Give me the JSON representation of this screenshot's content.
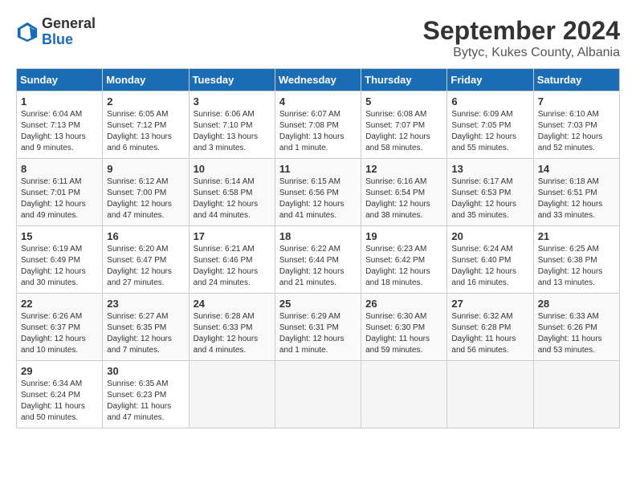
{
  "header": {
    "logo_general": "General",
    "logo_blue": "Blue",
    "title": "September 2024",
    "subtitle": "Bytyc, Kukes County, Albania"
  },
  "columns": [
    "Sunday",
    "Monday",
    "Tuesday",
    "Wednesday",
    "Thursday",
    "Friday",
    "Saturday"
  ],
  "weeks": [
    [
      {
        "day": "1",
        "info": "Sunrise: 6:04 AM\nSunset: 7:13 PM\nDaylight: 13 hours and 9 minutes."
      },
      {
        "day": "2",
        "info": "Sunrise: 6:05 AM\nSunset: 7:12 PM\nDaylight: 13 hours and 6 minutes."
      },
      {
        "day": "3",
        "info": "Sunrise: 6:06 AM\nSunset: 7:10 PM\nDaylight: 13 hours and 3 minutes."
      },
      {
        "day": "4",
        "info": "Sunrise: 6:07 AM\nSunset: 7:08 PM\nDaylight: 13 hours and 1 minute."
      },
      {
        "day": "5",
        "info": "Sunrise: 6:08 AM\nSunset: 7:07 PM\nDaylight: 12 hours and 58 minutes."
      },
      {
        "day": "6",
        "info": "Sunrise: 6:09 AM\nSunset: 7:05 PM\nDaylight: 12 hours and 55 minutes."
      },
      {
        "day": "7",
        "info": "Sunrise: 6:10 AM\nSunset: 7:03 PM\nDaylight: 12 hours and 52 minutes."
      }
    ],
    [
      {
        "day": "8",
        "info": "Sunrise: 6:11 AM\nSunset: 7:01 PM\nDaylight: 12 hours and 49 minutes."
      },
      {
        "day": "9",
        "info": "Sunrise: 6:12 AM\nSunset: 7:00 PM\nDaylight: 12 hours and 47 minutes."
      },
      {
        "day": "10",
        "info": "Sunrise: 6:14 AM\nSunset: 6:58 PM\nDaylight: 12 hours and 44 minutes."
      },
      {
        "day": "11",
        "info": "Sunrise: 6:15 AM\nSunset: 6:56 PM\nDaylight: 12 hours and 41 minutes."
      },
      {
        "day": "12",
        "info": "Sunrise: 6:16 AM\nSunset: 6:54 PM\nDaylight: 12 hours and 38 minutes."
      },
      {
        "day": "13",
        "info": "Sunrise: 6:17 AM\nSunset: 6:53 PM\nDaylight: 12 hours and 35 minutes."
      },
      {
        "day": "14",
        "info": "Sunrise: 6:18 AM\nSunset: 6:51 PM\nDaylight: 12 hours and 33 minutes."
      }
    ],
    [
      {
        "day": "15",
        "info": "Sunrise: 6:19 AM\nSunset: 6:49 PM\nDaylight: 12 hours and 30 minutes."
      },
      {
        "day": "16",
        "info": "Sunrise: 6:20 AM\nSunset: 6:47 PM\nDaylight: 12 hours and 27 minutes."
      },
      {
        "day": "17",
        "info": "Sunrise: 6:21 AM\nSunset: 6:46 PM\nDaylight: 12 hours and 24 minutes."
      },
      {
        "day": "18",
        "info": "Sunrise: 6:22 AM\nSunset: 6:44 PM\nDaylight: 12 hours and 21 minutes."
      },
      {
        "day": "19",
        "info": "Sunrise: 6:23 AM\nSunset: 6:42 PM\nDaylight: 12 hours and 18 minutes."
      },
      {
        "day": "20",
        "info": "Sunrise: 6:24 AM\nSunset: 6:40 PM\nDaylight: 12 hours and 16 minutes."
      },
      {
        "day": "21",
        "info": "Sunrise: 6:25 AM\nSunset: 6:38 PM\nDaylight: 12 hours and 13 minutes."
      }
    ],
    [
      {
        "day": "22",
        "info": "Sunrise: 6:26 AM\nSunset: 6:37 PM\nDaylight: 12 hours and 10 minutes."
      },
      {
        "day": "23",
        "info": "Sunrise: 6:27 AM\nSunset: 6:35 PM\nDaylight: 12 hours and 7 minutes."
      },
      {
        "day": "24",
        "info": "Sunrise: 6:28 AM\nSunset: 6:33 PM\nDaylight: 12 hours and 4 minutes."
      },
      {
        "day": "25",
        "info": "Sunrise: 6:29 AM\nSunset: 6:31 PM\nDaylight: 12 hours and 1 minute."
      },
      {
        "day": "26",
        "info": "Sunrise: 6:30 AM\nSunset: 6:30 PM\nDaylight: 11 hours and 59 minutes."
      },
      {
        "day": "27",
        "info": "Sunrise: 6:32 AM\nSunset: 6:28 PM\nDaylight: 11 hours and 56 minutes."
      },
      {
        "day": "28",
        "info": "Sunrise: 6:33 AM\nSunset: 6:26 PM\nDaylight: 11 hours and 53 minutes."
      }
    ],
    [
      {
        "day": "29",
        "info": "Sunrise: 6:34 AM\nSunset: 6:24 PM\nDaylight: 11 hours and 50 minutes."
      },
      {
        "day": "30",
        "info": "Sunrise: 6:35 AM\nSunset: 6:23 PM\nDaylight: 11 hours and 47 minutes."
      },
      {
        "day": "",
        "info": ""
      },
      {
        "day": "",
        "info": ""
      },
      {
        "day": "",
        "info": ""
      },
      {
        "day": "",
        "info": ""
      },
      {
        "day": "",
        "info": ""
      }
    ]
  ]
}
